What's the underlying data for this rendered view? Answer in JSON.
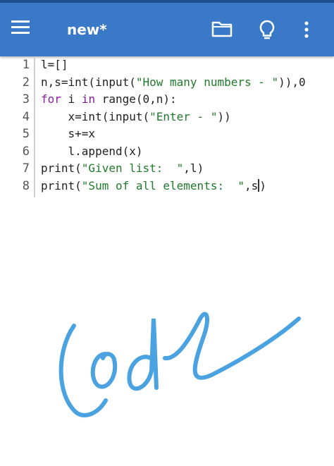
{
  "app": {
    "title": "new*"
  },
  "toolbar": {
    "menu_icon": "hamburger-menu-icon",
    "folder_icon": "folder-icon",
    "bulb_icon": "lightbulb-icon",
    "more_icon": "more-vert-icon"
  },
  "editor": {
    "line_numbers": [
      "1",
      "2",
      "3",
      "4",
      "5",
      "6",
      "7",
      "8"
    ],
    "lines": [
      [
        {
          "t": "l=[]",
          "c": "p"
        }
      ],
      [
        {
          "t": "n,s=int(input(",
          "c": "p"
        },
        {
          "t": "\"How many numbers - \"",
          "c": "s"
        },
        {
          "t": ")),0",
          "c": "p"
        }
      ],
      [
        {
          "t": "for",
          "c": "k"
        },
        {
          "t": " i ",
          "c": "p"
        },
        {
          "t": "in",
          "c": "k"
        },
        {
          "t": " range(0,n):",
          "c": "p"
        }
      ],
      [
        {
          "t": "    x=int(input(",
          "c": "p"
        },
        {
          "t": "\"Enter - \"",
          "c": "s"
        },
        {
          "t": "))",
          "c": "p"
        }
      ],
      [
        {
          "t": "    s+=x",
          "c": "p"
        }
      ],
      [
        {
          "t": "    l.append(x)",
          "c": "p"
        }
      ],
      [
        {
          "t": "print(",
          "c": "p"
        },
        {
          "t": "\"Given list:  \"",
          "c": "s"
        },
        {
          "t": ",l)",
          "c": "p"
        }
      ],
      [
        {
          "t": "print(",
          "c": "p"
        },
        {
          "t": "\"Sum of all elements:  \"",
          "c": "s"
        },
        {
          "t": ",s",
          "c": "p"
        },
        {
          "t": "|",
          "c": "cursor"
        },
        {
          "t": ")",
          "c": "p"
        }
      ]
    ]
  },
  "annotation": {
    "handwritten_text": "Code",
    "color": "#4aa3e0"
  },
  "colors": {
    "appbar": "#3a78c8",
    "keyword": "#8a1aa0",
    "string": "#1f7a2a",
    "plain": "#222222"
  }
}
